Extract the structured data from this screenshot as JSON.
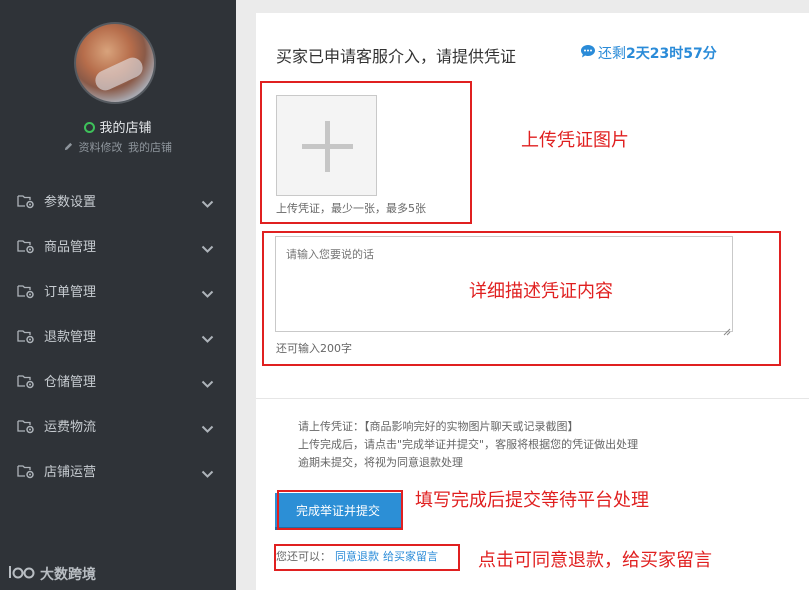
{
  "sidebar": {
    "store_label": "我的店铺",
    "edit_profile_link": "资料修改",
    "my_store_link": "我的店铺",
    "items": [
      {
        "label": "参数设置"
      },
      {
        "label": "商品管理"
      },
      {
        "label": "订单管理"
      },
      {
        "label": "退款管理"
      },
      {
        "label": "仓储管理"
      },
      {
        "label": "运费物流"
      },
      {
        "label": "店铺运营"
      }
    ],
    "brand": "大数跨境"
  },
  "main": {
    "title": "买家已申请客服介入，请提供凭证",
    "countdown": {
      "prefix": "还剩",
      "days": "2天",
      "hours": "23时",
      "minutes": "57分"
    },
    "upload_hint": "上传凭证，最少一张，最多5张",
    "description_placeholder": "请输入您要说的话",
    "remaining_chars": "还可输入200字",
    "notes": [
      "请上传凭证：【商品影响完好的实物图片聊天或记录截图】",
      "上传完成后，请点击\"完成举证并提交\"，客服将根据您的凭证做出处理",
      "逾期未提交，将视为同意退款处理"
    ],
    "submit_label": "完成举证并提交",
    "also_prefix": "您还可以：",
    "agree_refund_link": "同意退款",
    "leave_message_link": "给买家留言"
  },
  "annotations": {
    "upload_photos": "上传凭证图片",
    "describe_details": "详细描述凭证内容",
    "submit_wait": "填写完成后提交等待平台处理",
    "agree_or_message": "点击可同意退款，给买家留言"
  },
  "colors": {
    "sidebar_bg": "#2f3338",
    "accent_blue": "#2c8fd6",
    "annotation_red": "#e02020",
    "status_green": "#3ec15a"
  },
  "icons": {
    "menu": "folder-gear-icon",
    "chevron": "chevron-down-icon",
    "edit": "pencil-icon",
    "chat": "chat-bubble-icon",
    "upload": "plus-icon"
  }
}
